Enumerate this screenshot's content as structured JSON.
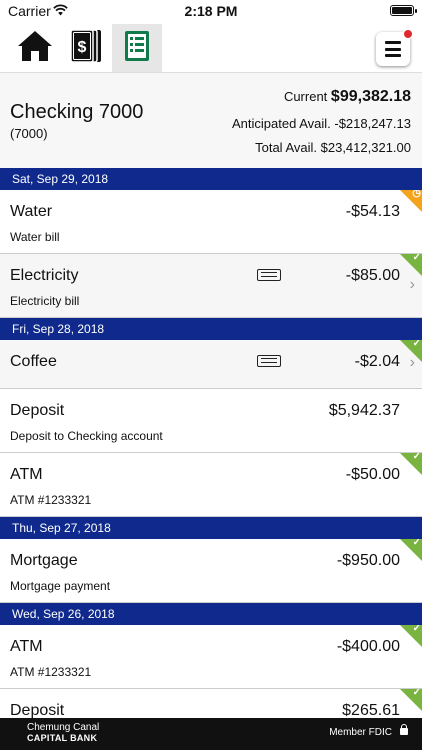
{
  "status_bar": {
    "carrier": "Carrier",
    "time": "2:18 PM"
  },
  "nav": {
    "tabs": [
      {
        "icon": "home-icon",
        "active": false
      },
      {
        "icon": "money-stack-icon",
        "active": false
      },
      {
        "icon": "list-document-icon",
        "active": true
      }
    ],
    "menu_icon": "hamburger-menu-icon",
    "colors": {
      "accent_green": "#0f7a4a",
      "notification": "#e0282f"
    }
  },
  "account": {
    "name": "Checking 7000",
    "number": "(7000)",
    "current_label": "Current",
    "current_value": "$99,382.18",
    "anticipated": "Anticipated Avail. -$218,247.13",
    "total": "Total Avail. $23,412,321.00"
  },
  "colors": {
    "date_header": "#0f2a8c",
    "cleared": "#7ab440",
    "pending": "#f4a31d"
  },
  "groups": [
    {
      "date": "Sat, Sep 29, 2018",
      "transactions": [
        {
          "name": "Water",
          "desc": "Water bill",
          "amount": "-$54.13",
          "status": "pending"
        },
        {
          "name": "Electricity",
          "desc": "Electricity bill",
          "amount": "-$85.00",
          "status": "cleared",
          "receipt": true,
          "chevron": true
        }
      ]
    },
    {
      "date": "Fri, Sep 28, 2018",
      "transactions": [
        {
          "name": "Coffee",
          "desc": "",
          "amount": "-$2.04",
          "status": "cleared",
          "receipt": true,
          "chevron": true
        },
        {
          "name": "Deposit",
          "desc": "Deposit to Checking account",
          "amount": "$5,942.37",
          "status": ""
        },
        {
          "name": "ATM",
          "desc": "ATM #1233321",
          "amount": "-$50.00",
          "status": "cleared"
        }
      ]
    },
    {
      "date": "Thu, Sep 27, 2018",
      "transactions": [
        {
          "name": "Mortgage",
          "desc": "Mortgage payment",
          "amount": "-$950.00",
          "status": "cleared"
        }
      ]
    },
    {
      "date": "Wed, Sep 26, 2018",
      "transactions": [
        {
          "name": "ATM",
          "desc": "ATM #1233321",
          "amount": "-$400.00",
          "status": "cleared"
        },
        {
          "name": "Deposit",
          "desc": "",
          "amount": "$265.61",
          "status": "cleared"
        }
      ]
    }
  ],
  "footer": {
    "brand_line1": "Chemung Canal",
    "brand_line2": "CAPITAL BANK",
    "fdic": "Member FDIC"
  }
}
